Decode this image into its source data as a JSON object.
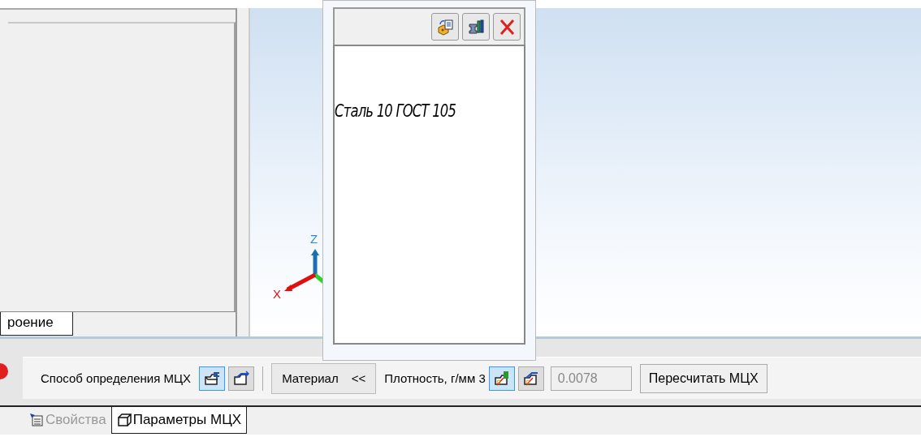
{
  "left_panel": {
    "tab": {
      "label": "роение",
      "selected": true
    }
  },
  "viewport": {
    "axes": {
      "z_label": "Z",
      "x_label": "X"
    }
  },
  "material_panel": {
    "buttons": [
      {
        "kind": "load"
      },
      {
        "kind": "library"
      },
      {
        "kind": "close"
      }
    ],
    "material": "Сталь 10  ГОСТ 105"
  },
  "toolbar": {
    "method_label": "Способ определения МЦХ",
    "method_buttons": [
      {
        "kind": "folder-list",
        "selected": true
      },
      {
        "kind": "folder-arrow",
        "selected": false
      }
    ],
    "material_button": {
      "label": "Материал",
      "toggle": "<<"
    },
    "density_label": "Плотность, г/мм 3",
    "density_buttons": [
      {
        "kind": "density-book",
        "selected": true
      },
      {
        "kind": "density-arrow",
        "selected": false
      }
    ],
    "density_value": {
      "value": "0.0078",
      "disabled": true
    },
    "recalc_button": "Пересчитать МЦХ"
  },
  "tabs": [
    {
      "label": "Свойства",
      "selected": false
    },
    {
      "label": "Параметры МЦХ",
      "selected": true
    }
  ]
}
